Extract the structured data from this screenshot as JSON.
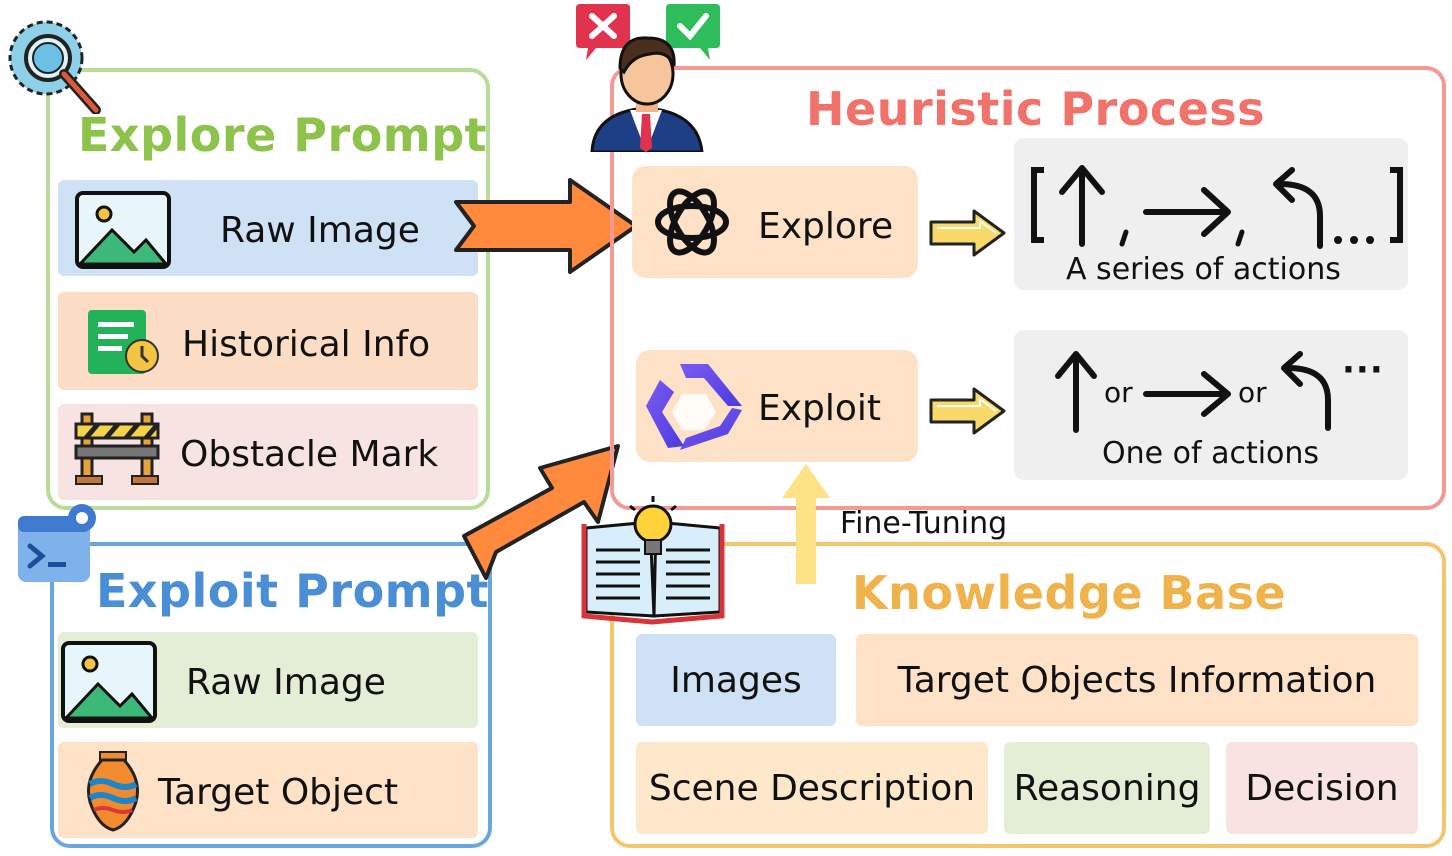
{
  "explore_prompt": {
    "title": "Explore Prompt",
    "items": [
      {
        "label": "Raw Image",
        "icon": "image-icon"
      },
      {
        "label": "Historical Info",
        "icon": "document-clock-icon"
      },
      {
        "label": "Obstacle Mark",
        "icon": "barrier-icon"
      }
    ]
  },
  "exploit_prompt": {
    "title": "Exploit Prompt",
    "items": [
      {
        "label": "Raw Image",
        "icon": "image-icon"
      },
      {
        "label": "Target Object",
        "icon": "vase-icon"
      }
    ]
  },
  "heuristic_process": {
    "title": "Heuristic Process",
    "explore": {
      "label": "Explore",
      "icon": "openai-logo-icon"
    },
    "exploit": {
      "label": "Exploit",
      "icon": "qwen-logo-icon"
    },
    "explore_output": {
      "sequence": "[↑ , → , ↶ …]",
      "caption": "A series of actions"
    },
    "exploit_output": {
      "or1": "or",
      "or2": "or",
      "ellipsis": "···",
      "caption": "One of actions"
    }
  },
  "fine_tuning_label": "Fine-Tuning",
  "knowledge_base": {
    "title": "Knowledge Base",
    "items": [
      "Images",
      "Target Objects Information",
      "Scene Description",
      "Reasoning",
      "Decision"
    ]
  },
  "colors": {
    "explore_green": "#8dc34a",
    "exploit_blue": "#4a8fd6",
    "heuristic_red": "#f0726a",
    "knowledge_orange": "#f0b24a",
    "arrow_orange": "#ff8a3d"
  }
}
